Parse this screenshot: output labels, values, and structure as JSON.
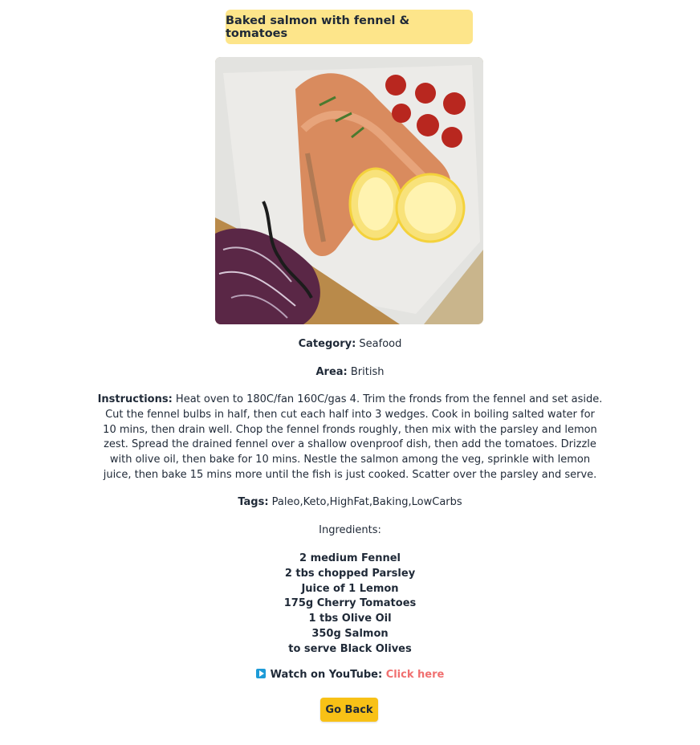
{
  "recipe": {
    "title": "Baked salmon with fennel & tomatoes",
    "category_label": "Category:",
    "category": "Seafood",
    "area_label": "Area:",
    "area": "British",
    "instructions_label": "Instructions:",
    "instructions": "Heat oven to 180C/fan 160C/gas 4. Trim the fronds from the fennel and set aside. Cut the fennel bulbs in half, then cut each half into 3 wedges. Cook in boiling salted water for 10 mins, then drain well. Chop the fennel fronds roughly, then mix with the parsley and lemon zest. Spread the drained fennel over a shallow ovenproof dish, then add the tomatoes. Drizzle with olive oil, then bake for 10 mins. Nestle the salmon among the veg, sprinkle with lemon juice, then bake 15 mins more until the fish is just cooked. Scatter over the parsley and serve.",
    "tags_label": "Tags:",
    "tags": "Paleo,Keto,HighFat,Baking,LowCarbs",
    "ingredients_heading": "Ingredients:",
    "ingredients": [
      "2 medium Fennel",
      "2 tbs chopped Parsley",
      "Juice of 1 Lemon",
      "175g Cherry Tomatoes",
      "1 tbs Olive Oil",
      "350g Salmon",
      "to serve Black Olives"
    ],
    "youtube_label": "Watch on YouTube:",
    "youtube_link": "Click here",
    "youtube_icon": "play-icon"
  },
  "actions": {
    "back_label": "Go Back"
  },
  "colors": {
    "title_bg": "#fde58a",
    "button_bg": "#f8c116",
    "link": "#f07070",
    "text": "#1f2937"
  }
}
